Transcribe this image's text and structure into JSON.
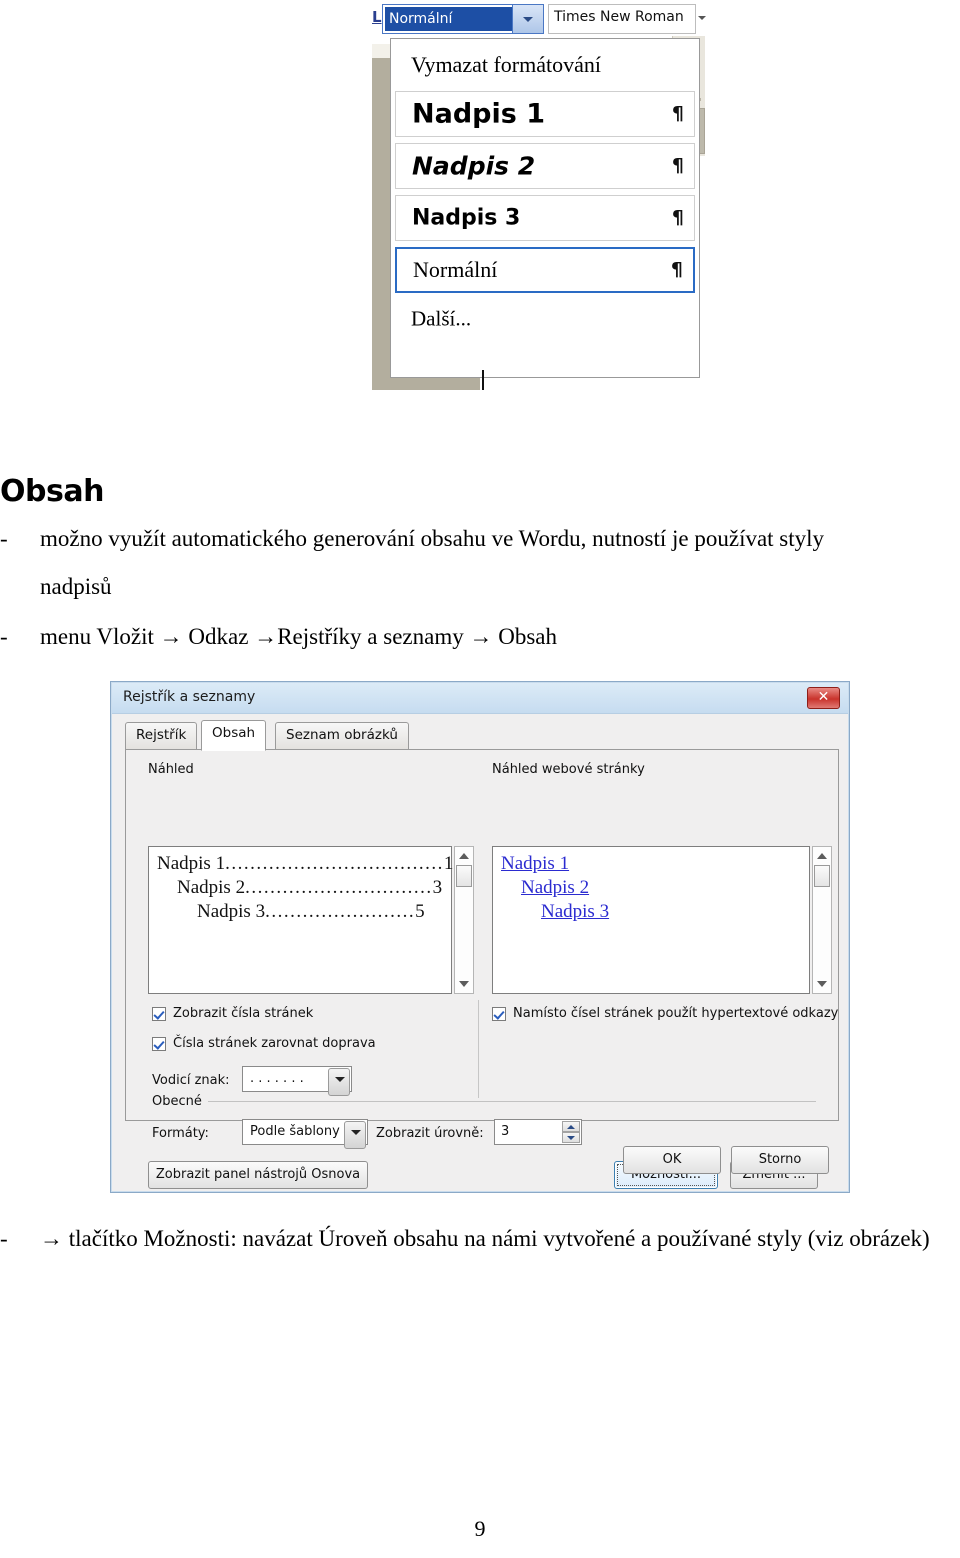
{
  "style_dropdown": {
    "letter_icon": "L",
    "selected_style": "Normální",
    "font_name": "Times New Roman",
    "items": [
      {
        "label": "Vymazat formátování",
        "pilcrow": ""
      },
      {
        "label": "Nadpis 1",
        "pilcrow": "¶"
      },
      {
        "label": "Nadpis 2",
        "pilcrow": "¶"
      },
      {
        "label": "Nadpis 3",
        "pilcrow": "¶"
      },
      {
        "label": "Normální",
        "pilcrow": "¶"
      },
      {
        "label": "Další...",
        "pilcrow": ""
      }
    ]
  },
  "document": {
    "heading": "Obsah",
    "bullets": [
      {
        "marker": "-",
        "line1": "možno využít automatického generování obsahu ve Wordu, nutností je používat styly",
        "line2": "nadpisů"
      },
      {
        "marker": "-",
        "line1": "menu Vložit → Odkaz →Rejstříky a seznamy → Obsah",
        "line2": ""
      },
      {
        "marker": "-",
        "line1": "→ tlačítko Možnosti: navázat Úroveň obsahu na námi vytvořené a používané styly (viz",
        "line2": "obrázek)"
      }
    ],
    "page_number": "9"
  },
  "dialog": {
    "title": "Rejstřík a seznamy",
    "close_label": "✕",
    "tabs": [
      {
        "label": "Rejstřík",
        "active": false
      },
      {
        "label": "Obsah",
        "active": true
      },
      {
        "label": "Seznam obrázků",
        "active": false
      }
    ],
    "preview": {
      "label": "Náhled",
      "entries": [
        {
          "text": "Nadpis 1",
          "dots": "...................................",
          "page": "1"
        },
        {
          "text": "Nadpis 2",
          "dots": "..............................",
          "page": "3"
        },
        {
          "text": "Nadpis 3",
          "dots": "........................",
          "page": "5"
        }
      ]
    },
    "web_preview": {
      "label": "Náhled webové stránky",
      "label_accel": "w",
      "entries": [
        "Nadpis 1",
        "Nadpis 2",
        "Nadpis 3"
      ]
    },
    "checkboxes": [
      {
        "label": "Zobrazit čísla stránek",
        "checked": true
      },
      {
        "label": "Čísla stránek zarovnat doprava",
        "checked": true
      },
      {
        "label": "Namísto čísel stránek použít hypertextové odkazy",
        "checked": true
      }
    ],
    "leader_label": "Vodicí znak:",
    "leader_value": ". . . . . . .",
    "general_group_label": "Obecné",
    "formats_label": "Formáty:",
    "formats_value": "Podle šablony",
    "levels_label": "Zobrazit úrovně:",
    "levels_value": "3",
    "outline_button": "Zobrazit panel nástrojů Osnova",
    "options_button": "Možnosti...",
    "modify_button": "Změnit ...",
    "ok_button": "OK",
    "cancel_button": "Storno"
  },
  "colors": {
    "title_gradient_top": "#dcebf7",
    "title_gradient_bottom": "#c6dcf0",
    "close_red": "#c9332c",
    "link_blue": "#2b2bd0",
    "selection_blue": "#1d4fa5",
    "focus_blue": "#3c7fb1"
  }
}
